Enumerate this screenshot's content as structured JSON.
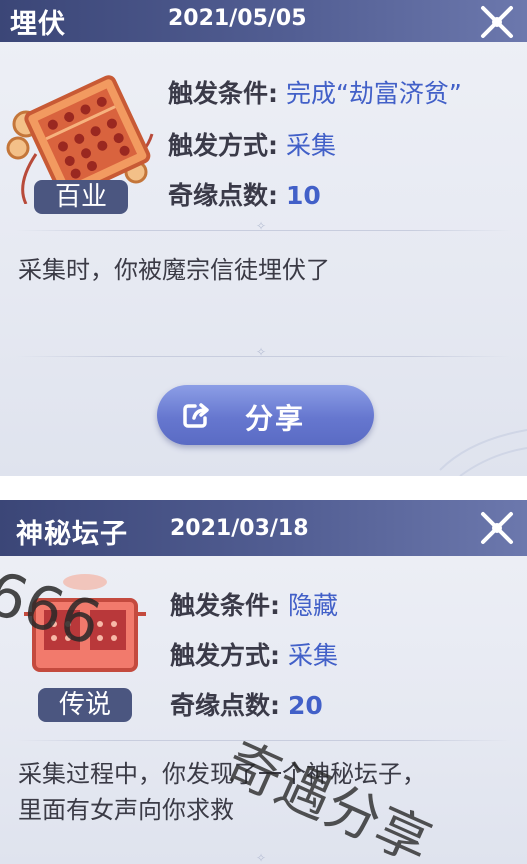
{
  "card1": {
    "title": "埋伏",
    "date": "2021/05/05",
    "badge": "百业",
    "trigger_condition_label": "触发条件:",
    "trigger_condition_value": "完成“劫富济贫”",
    "trigger_method_label": "触发方式:",
    "trigger_method_value": "采集",
    "points_label": "奇缘点数:",
    "points_value": "10",
    "description": "采集时，你被魔宗信徒埋伏了",
    "share_label": "分享",
    "icon": "abacus-icon"
  },
  "card2": {
    "title": "神秘坛子",
    "date": "2021/03/18",
    "badge": "传说",
    "trigger_condition_label": "触发条件:",
    "trigger_condition_value": "隐藏",
    "trigger_method_label": "触发方式:",
    "trigger_method_value": "采集",
    "points_label": "奇缘点数:",
    "points_value": "20",
    "description_line1": "采集过程中，你发现了一个神秘坛子，",
    "description_line2": "里面有女声向你求救",
    "icon": "jar-icon"
  },
  "watermark": {
    "number": "666",
    "text": "奇遇分享"
  },
  "colors": {
    "header": "#4a5588",
    "value_blue": "#4260c8",
    "badge": "#4b5680",
    "button": "#6a7bd4"
  }
}
